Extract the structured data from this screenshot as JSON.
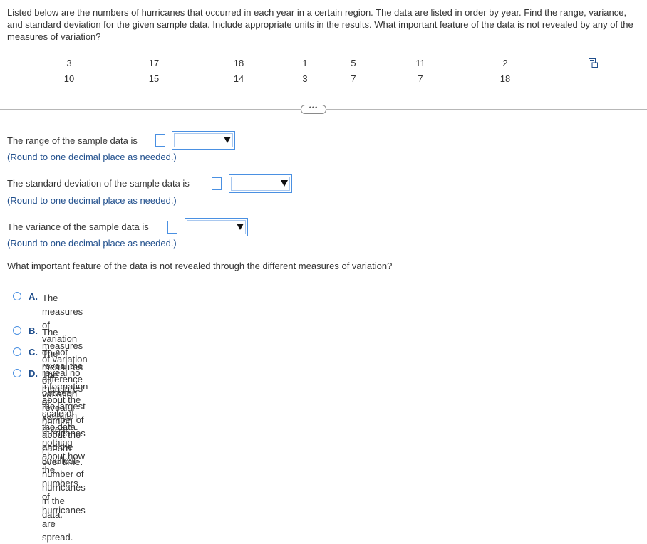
{
  "question": "Listed below are the numbers of hurricanes that occurred in each year in a certain region. The data are listed in order by year. Find the range, variance, and standard deviation for the given sample data. Include appropriate units in the results. What important feature of the data is not revealed by any of the measures of variation?",
  "data_rows": [
    [
      "3",
      "17",
      "18",
      "1",
      "5",
      "11",
      "2"
    ],
    [
      "10",
      "15",
      "14",
      "3",
      "7",
      "7",
      "18"
    ]
  ],
  "more_button": "•••",
  "range": {
    "label": "The range of the sample data is",
    "hint": "(Round to one decimal place as needed.)"
  },
  "std": {
    "label": "The standard deviation of the sample data is",
    "hint": "(Round to one decimal place as needed.)"
  },
  "variance": {
    "label": "The variance of the sample data is",
    "hint": "(Round to one decimal place as needed.)"
  },
  "feature_question": "What important feature of the data is not revealed through the different measures of variation?",
  "options": [
    {
      "letter": "A.",
      "text_line1": "The measures of variation do not reveal the difference between the largest number of hurricanes and the smallest number of",
      "text_line2": "hurricanes in the data."
    },
    {
      "letter": "B.",
      "text_line1": "The measures of variation reveal no information about the scale of the data.",
      "text_line2": ""
    },
    {
      "letter": "C.",
      "text_line1": "The measures of variation reveal nothing about the pattern over time.",
      "text_line2": ""
    },
    {
      "letter": "D.",
      "text_line1": "The measures of variation reveal nothing about how the numbers of hurricanes are spread.",
      "text_line2": ""
    }
  ],
  "colors": {
    "accent": "#4a90e2",
    "hint_text": "#1f4e8c",
    "body_text": "#333333"
  },
  "icons": {
    "copy": "copy-icon",
    "dropdown": "chevron-down-icon"
  }
}
